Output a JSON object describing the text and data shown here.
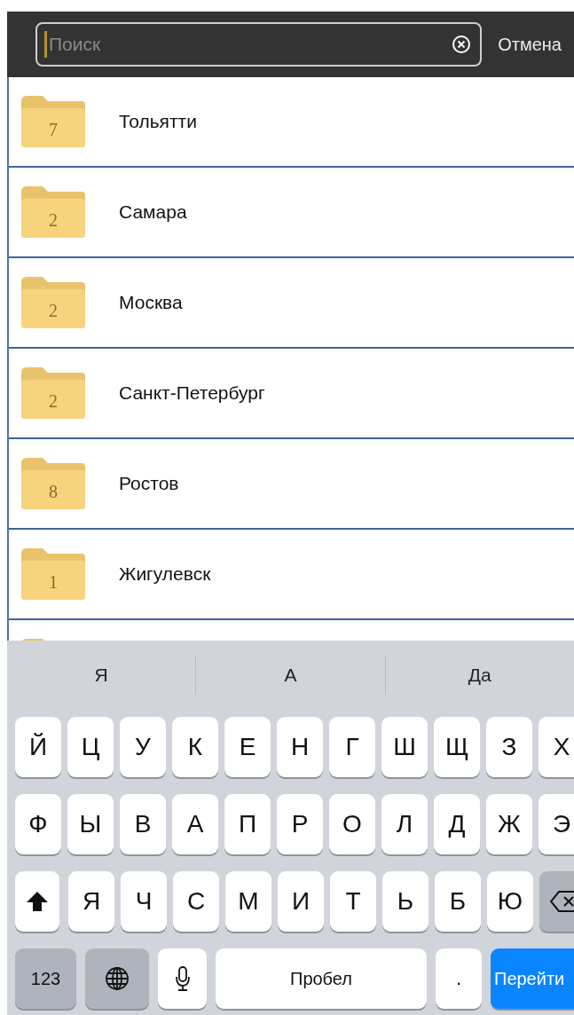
{
  "search": {
    "placeholder": "Поиск",
    "cancel": "Отмена"
  },
  "folders": [
    {
      "count": "7",
      "name": "Тольятти"
    },
    {
      "count": "2",
      "name": "Самара"
    },
    {
      "count": "2",
      "name": "Москва"
    },
    {
      "count": "2",
      "name": "Санкт-Петербург"
    },
    {
      "count": "8",
      "name": "Ростов"
    },
    {
      "count": "1",
      "name": "Жигулевск"
    }
  ],
  "keyboard": {
    "suggestions": [
      "Я",
      "А",
      "Да"
    ],
    "rows": [
      [
        {
          "kind": "letter",
          "label": "Й"
        },
        {
          "kind": "letter",
          "label": "Ц"
        },
        {
          "kind": "letter",
          "label": "У"
        },
        {
          "kind": "letter",
          "label": "К"
        },
        {
          "kind": "letter",
          "label": "Е"
        },
        {
          "kind": "letter",
          "label": "Н"
        },
        {
          "kind": "letter",
          "label": "Г"
        },
        {
          "kind": "letter",
          "label": "Ш"
        },
        {
          "kind": "letter",
          "label": "Щ"
        },
        {
          "kind": "letter",
          "label": "З"
        },
        {
          "kind": "letter",
          "label": "Х"
        }
      ],
      [
        {
          "kind": "letter",
          "label": "Ф"
        },
        {
          "kind": "letter",
          "label": "Ы"
        },
        {
          "kind": "letter",
          "label": "В"
        },
        {
          "kind": "letter",
          "label": "А"
        },
        {
          "kind": "letter",
          "label": "П"
        },
        {
          "kind": "letter",
          "label": "Р"
        },
        {
          "kind": "letter",
          "label": "О"
        },
        {
          "kind": "letter",
          "label": "Л"
        },
        {
          "kind": "letter",
          "label": "Д"
        },
        {
          "kind": "letter",
          "label": "Ж"
        },
        {
          "kind": "letter",
          "label": "Э"
        }
      ],
      [
        {
          "kind": "shift"
        },
        {
          "kind": "letter",
          "label": "Я"
        },
        {
          "kind": "letter",
          "label": "Ч"
        },
        {
          "kind": "letter",
          "label": "С"
        },
        {
          "kind": "letter",
          "label": "М"
        },
        {
          "kind": "letter",
          "label": "И"
        },
        {
          "kind": "letter",
          "label": "Т"
        },
        {
          "kind": "letter",
          "label": "Ь"
        },
        {
          "kind": "letter",
          "label": "Б"
        },
        {
          "kind": "letter",
          "label": "Ю"
        },
        {
          "kind": "backspace"
        }
      ]
    ],
    "numbers_key": "123",
    "space_key": "Пробел",
    "period_key": ".",
    "go_key": "Перейти"
  }
}
